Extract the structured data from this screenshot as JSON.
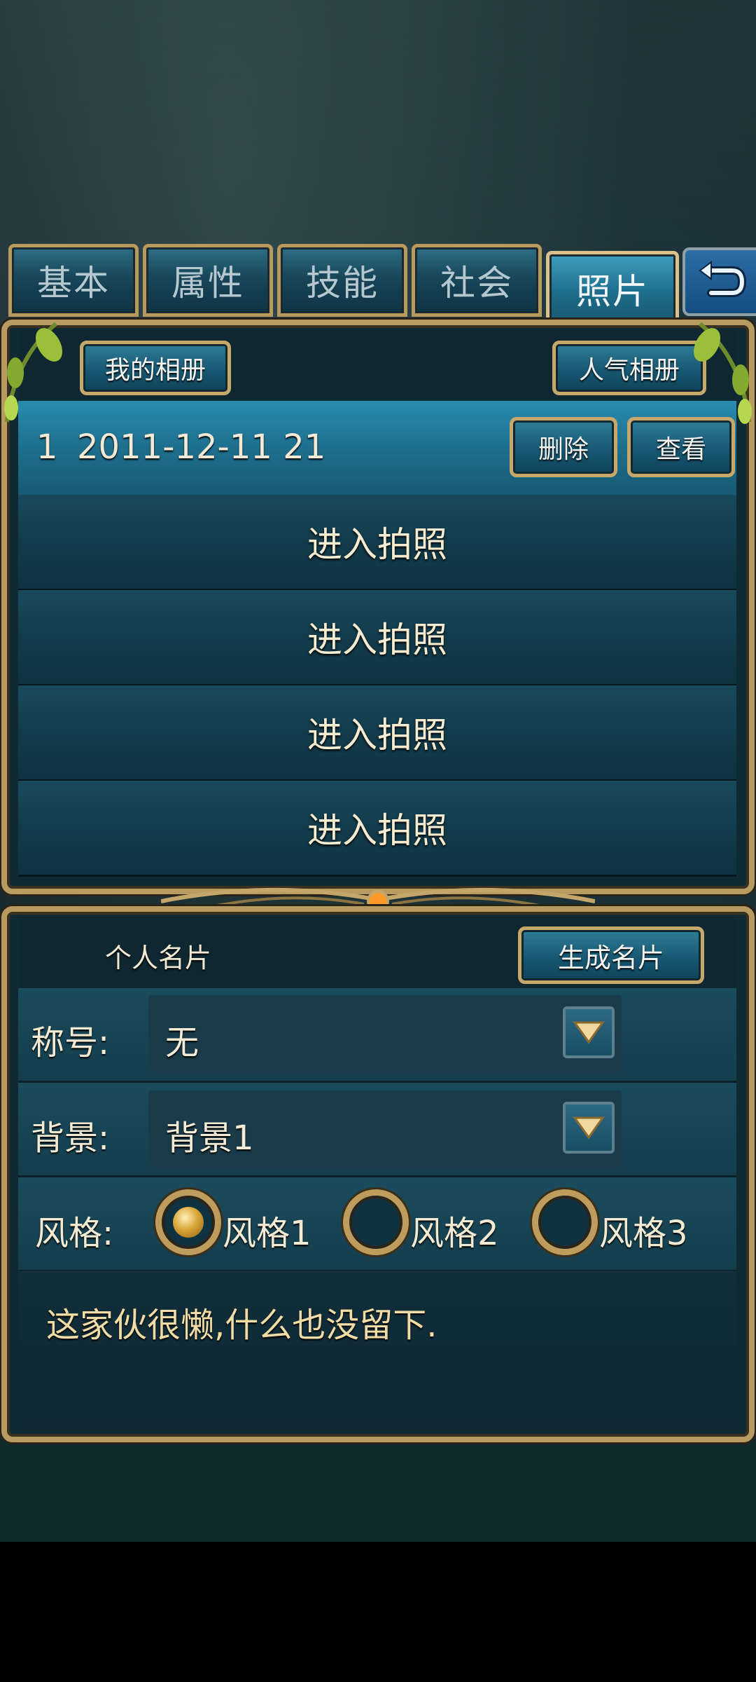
{
  "tabs": [
    {
      "label": "基本",
      "active": false
    },
    {
      "label": "属性",
      "active": false
    },
    {
      "label": "技能",
      "active": false
    },
    {
      "label": "社会",
      "active": false
    },
    {
      "label": "照片",
      "active": true
    }
  ],
  "back_icon": "return-arrow-icon",
  "album": {
    "my_album_label": "我的相册",
    "popular_album_label": "人气相册",
    "entry": {
      "index": "1",
      "datetime": "2011-12-11 21",
      "delete_label": "删除",
      "view_label": "查看"
    },
    "photo_slots": [
      {
        "label": "进入拍照"
      },
      {
        "label": "进入拍照"
      },
      {
        "label": "进入拍照"
      },
      {
        "label": "进入拍照"
      }
    ]
  },
  "card": {
    "title": "个人名片",
    "generate_label": "生成名片",
    "title_field": {
      "label": "称号:",
      "value": "无"
    },
    "background_field": {
      "label": "背景:",
      "value": "背景1"
    },
    "style_field": {
      "label": "风格:",
      "options": [
        "风格1",
        "风格2",
        "风格3"
      ],
      "selected": "风格1"
    },
    "signature": "这家伙很懒,什么也没留下."
  },
  "colors": {
    "gold_border": "#b79b60",
    "panel_bg": "#0f2a33",
    "text_cream": "#f3ead4",
    "tab_active": "#1e6e8c"
  }
}
